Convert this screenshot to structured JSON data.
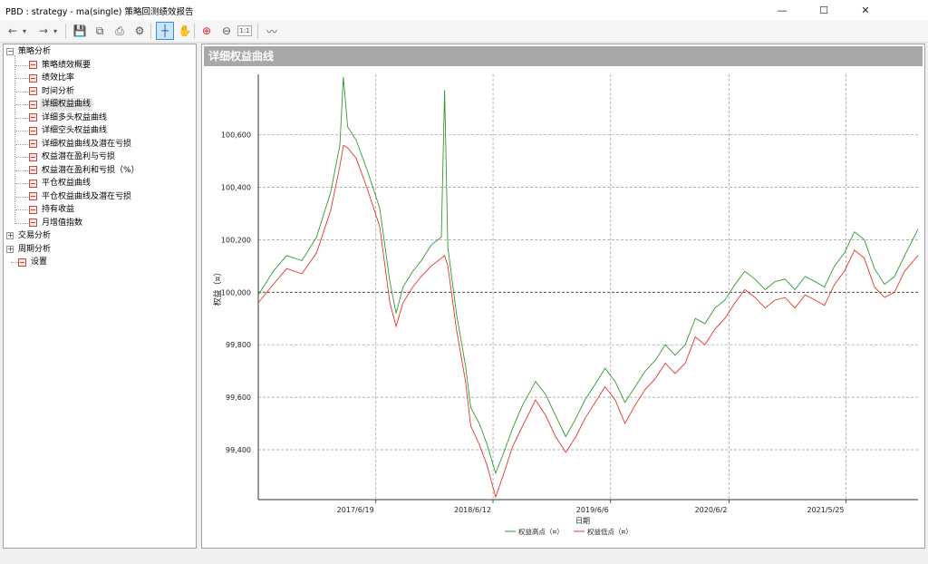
{
  "window": {
    "title": "PBD : strategy - ma(single) 策略回测绩效报告",
    "minimize_glyph": "—",
    "maximize_glyph": "☐",
    "close_glyph": "✕"
  },
  "toolbar": {
    "items": [
      {
        "name": "back-icon",
        "glyph": "←"
      },
      {
        "name": "back-dropdown-icon",
        "glyph": "▾"
      },
      {
        "name": "forward-icon",
        "glyph": "→"
      },
      {
        "name": "forward-dropdown-icon",
        "glyph": "▾"
      },
      {
        "name": "save-icon",
        "glyph": "💾"
      },
      {
        "name": "copy-icon",
        "glyph": "⧉"
      },
      {
        "name": "print-icon",
        "glyph": "⎙"
      },
      {
        "name": "settings-icon",
        "glyph": "⚙"
      },
      {
        "name": "crosshair-icon",
        "glyph": "┼"
      },
      {
        "name": "pan-icon",
        "glyph": "✋"
      },
      {
        "name": "zoom-in-icon",
        "glyph": "⊕"
      },
      {
        "name": "zoom-out-icon",
        "glyph": "⊖"
      },
      {
        "name": "reset-zoom-icon",
        "glyph": "1:1"
      },
      {
        "name": "chart-style-icon",
        "glyph": "〰"
      }
    ]
  },
  "tree": {
    "strategy_analysis": "策略分析",
    "items": [
      "策略绩效概要",
      "绩效比率",
      "时间分析",
      "详细权益曲线",
      "详细多头权益曲线",
      "详细空头权益曲线",
      "详细权益曲线及潜在亏损",
      "权益潜在盈利与亏损",
      "权益潜在盈利和亏损（%）",
      "平仓权益曲线",
      "平仓权益曲线及潜在亏损",
      "持有收益",
      "月增值指数"
    ],
    "trade_analysis": "交易分析",
    "period_analysis": "周期分析",
    "settings": "设置",
    "selected_index": 3
  },
  "panel": {
    "title": "详细权益曲线"
  },
  "chart_data": {
    "type": "line",
    "title": "",
    "xlabel": "日期",
    "ylabel": "权益（¤）",
    "x_ticks": [
      "2017/6/19",
      "2018/6/12",
      "2019/6/6",
      "2020/6/2",
      "2021/5/25"
    ],
    "y_ticks": [
      "99,400",
      "99,600",
      "99,800",
      "100,000",
      "100,200",
      "100,400",
      "100,600"
    ],
    "ylim": [
      99210,
      100830
    ],
    "xlim": [
      "2016/6/25",
      "2021/12/31"
    ],
    "baseline": 100000,
    "grid": true,
    "legend_position": "bottom",
    "series": [
      {
        "name": "权益高点（¤）",
        "color": "#2e9b2e",
        "points": [
          [
            "2016/6/25",
            99990
          ],
          [
            "2016/8/10",
            100080
          ],
          [
            "2016/9/20",
            100140
          ],
          [
            "2016/11/5",
            100120
          ],
          [
            "2016/12/20",
            100210
          ],
          [
            "2017/2/1",
            100380
          ],
          [
            "2017/3/1",
            100560
          ],
          [
            "2017/3/12",
            100820
          ],
          [
            "2017/3/25",
            100630
          ],
          [
            "2017/4/20",
            100580
          ],
          [
            "2017/5/25",
            100460
          ],
          [
            "2017/7/1",
            100320
          ],
          [
            "2017/8/1",
            100040
          ],
          [
            "2017/8/20",
            99920
          ],
          [
            "2017/9/10",
            100020
          ],
          [
            "2017/10/10",
            100080
          ],
          [
            "2017/11/5",
            100120
          ],
          [
            "2017/12/5",
            100180
          ],
          [
            "2018/1/5",
            100210
          ],
          [
            "2018/1/15",
            100770
          ],
          [
            "2018/1/25",
            100170
          ],
          [
            "2018/2/20",
            99920
          ],
          [
            "2018/3/20",
            99720
          ],
          [
            "2018/4/5",
            99560
          ],
          [
            "2018/5/1",
            99500
          ],
          [
            "2018/5/25",
            99420
          ],
          [
            "2018/6/20",
            99310
          ],
          [
            "2018/7/15",
            99390
          ],
          [
            "2018/8/10",
            99480
          ],
          [
            "2018/9/10",
            99570
          ],
          [
            "2018/10/20",
            99660
          ],
          [
            "2018/11/20",
            99610
          ],
          [
            "2018/12/20",
            99530
          ],
          [
            "2019/1/20",
            99450
          ],
          [
            "2019/2/20",
            99520
          ],
          [
            "2019/3/20",
            99590
          ],
          [
            "2019/4/20",
            99650
          ],
          [
            "2019/5/20",
            99710
          ],
          [
            "2019/6/20",
            99660
          ],
          [
            "2019/7/20",
            99580
          ],
          [
            "2019/8/20",
            99640
          ],
          [
            "2019/9/20",
            99700
          ],
          [
            "2019/10/20",
            99740
          ],
          [
            "2019/11/20",
            99800
          ],
          [
            "2019/12/20",
            99760
          ],
          [
            "2020/1/20",
            99800
          ],
          [
            "2020/2/20",
            99900
          ],
          [
            "2020/3/20",
            99880
          ],
          [
            "2020/4/20",
            99940
          ],
          [
            "2020/5/20",
            99970
          ],
          [
            "2020/6/20",
            100030
          ],
          [
            "2020/7/20",
            100080
          ],
          [
            "2020/8/20",
            100050
          ],
          [
            "2020/9/20",
            100010
          ],
          [
            "2020/10/20",
            100040
          ],
          [
            "2020/11/20",
            100050
          ],
          [
            "2020/12/20",
            100010
          ],
          [
            "2021/1/20",
            100060
          ],
          [
            "2021/2/20",
            100040
          ],
          [
            "2021/3/20",
            100020
          ],
          [
            "2021/4/20",
            100100
          ],
          [
            "2021/5/20",
            100150
          ],
          [
            "2021/6/20",
            100230
          ],
          [
            "2021/7/20",
            100200
          ],
          [
            "2021/8/20",
            100090
          ],
          [
            "2021/9/20",
            100030
          ],
          [
            "2021/10/20",
            100060
          ],
          [
            "2021/11/20",
            100140
          ],
          [
            "2021/12/31",
            100240
          ]
        ]
      },
      {
        "name": "权益低点（¤）",
        "color": "#e8322a",
        "points": [
          [
            "2016/6/25",
            99960
          ],
          [
            "2016/8/10",
            100030
          ],
          [
            "2016/9/20",
            100090
          ],
          [
            "2016/11/5",
            100070
          ],
          [
            "2016/12/20",
            100150
          ],
          [
            "2017/2/1",
            100310
          ],
          [
            "2017/3/1",
            100480
          ],
          [
            "2017/3/12",
            100560
          ],
          [
            "2017/3/25",
            100550
          ],
          [
            "2017/4/20",
            100510
          ],
          [
            "2017/5/25",
            100390
          ],
          [
            "2017/7/1",
            100250
          ],
          [
            "2017/8/1",
            99960
          ],
          [
            "2017/8/20",
            99870
          ],
          [
            "2017/9/10",
            99960
          ],
          [
            "2017/10/10",
            100020
          ],
          [
            "2017/11/5",
            100060
          ],
          [
            "2017/12/5",
            100100
          ],
          [
            "2018/1/5",
            100130
          ],
          [
            "2018/1/15",
            100140
          ],
          [
            "2018/1/25",
            100100
          ],
          [
            "2018/2/20",
            99860
          ],
          [
            "2018/3/20",
            99660
          ],
          [
            "2018/4/5",
            99490
          ],
          [
            "2018/5/1",
            99420
          ],
          [
            "2018/5/25",
            99340
          ],
          [
            "2018/6/20",
            99220
          ],
          [
            "2018/7/15",
            99310
          ],
          [
            "2018/8/10",
            99410
          ],
          [
            "2018/9/10",
            99490
          ],
          [
            "2018/10/20",
            99590
          ],
          [
            "2018/11/20",
            99530
          ],
          [
            "2018/12/20",
            99450
          ],
          [
            "2019/1/20",
            99390
          ],
          [
            "2019/2/20",
            99450
          ],
          [
            "2019/3/20",
            99520
          ],
          [
            "2019/4/20",
            99580
          ],
          [
            "2019/5/20",
            99640
          ],
          [
            "2019/6/20",
            99590
          ],
          [
            "2019/7/20",
            99500
          ],
          [
            "2019/8/20",
            99570
          ],
          [
            "2019/9/20",
            99630
          ],
          [
            "2019/10/20",
            99670
          ],
          [
            "2019/11/20",
            99730
          ],
          [
            "2019/12/20",
            99690
          ],
          [
            "2020/1/20",
            99730
          ],
          [
            "2020/2/20",
            99830
          ],
          [
            "2020/3/20",
            99800
          ],
          [
            "2020/4/20",
            99860
          ],
          [
            "2020/5/20",
            99900
          ],
          [
            "2020/6/20",
            99960
          ],
          [
            "2020/7/20",
            100010
          ],
          [
            "2020/8/20",
            99980
          ],
          [
            "2020/9/20",
            99940
          ],
          [
            "2020/10/20",
            99970
          ],
          [
            "2020/11/20",
            99980
          ],
          [
            "2020/12/20",
            99940
          ],
          [
            "2021/1/20",
            99990
          ],
          [
            "2021/2/20",
            99970
          ],
          [
            "2021/3/20",
            99950
          ],
          [
            "2021/4/20",
            100030
          ],
          [
            "2021/5/20",
            100080
          ],
          [
            "2021/6/20",
            100160
          ],
          [
            "2021/7/20",
            100130
          ],
          [
            "2021/8/20",
            100020
          ],
          [
            "2021/9/20",
            99980
          ],
          [
            "2021/10/20",
            100000
          ],
          [
            "2021/11/20",
            100080
          ],
          [
            "2021/12/31",
            100140
          ]
        ]
      }
    ]
  }
}
